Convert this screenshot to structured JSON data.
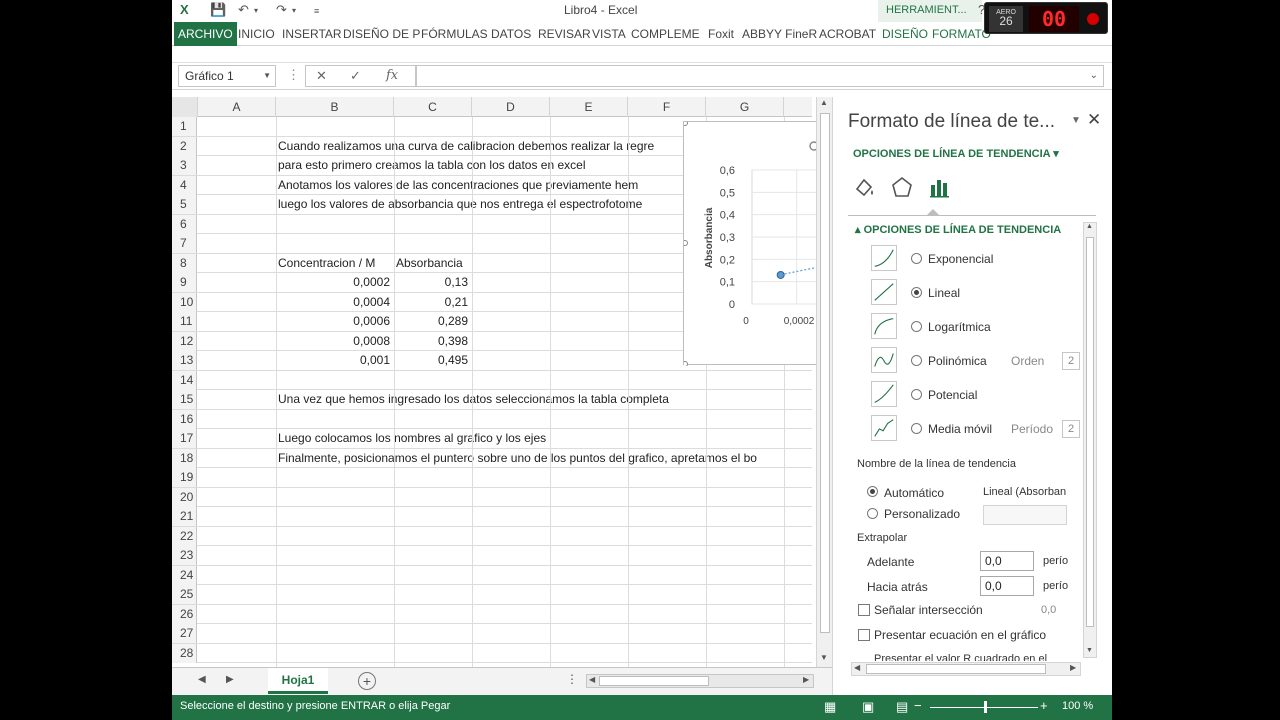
{
  "window": {
    "title": "Libro4 - Excel",
    "context_tab_group": "HERRAMIENT..."
  },
  "ribbon_tabs": [
    {
      "label": "ARCHIVO"
    },
    {
      "label": "INICIO"
    },
    {
      "label": "INSERTAR"
    },
    {
      "label": "DISEÑO DE P"
    },
    {
      "label": "FÓRMULAS"
    },
    {
      "label": "DATOS"
    },
    {
      "label": "REVISAR"
    },
    {
      "label": "VISTA"
    },
    {
      "label": "COMPLEME"
    },
    {
      "label": "Foxit"
    },
    {
      "label": "ABBYY FineR"
    },
    {
      "label": "ACROBAT"
    },
    {
      "label": "DISEÑO"
    },
    {
      "label": "FORMATO"
    }
  ],
  "formula_bar": {
    "name_box": "Gráfico 1",
    "fx_label": "fx",
    "value": ""
  },
  "columns": [
    "A",
    "B",
    "C",
    "D",
    "E",
    "F",
    "G"
  ],
  "rows": [
    {
      "n": "1"
    },
    {
      "n": "2",
      "b": "Cuando realizamos una curva de calibracion debemos realizar la regre"
    },
    {
      "n": "3",
      "b": "para esto primero creamos la tabla con los datos en excel"
    },
    {
      "n": "4",
      "b": "Anotamos los valores de las concentraciones que previamente hem"
    },
    {
      "n": "5",
      "b": "luego los valores de absorbancia que nos entrega el espectrofotome"
    },
    {
      "n": "6"
    },
    {
      "n": "7"
    },
    {
      "n": "8",
      "b": "Concentracion / M",
      "c": "Absorbancia"
    },
    {
      "n": "9",
      "b": "0,0002",
      "c": "0,13",
      "numeric": true
    },
    {
      "n": "10",
      "b": "0,0004",
      "c": "0,21",
      "numeric": true
    },
    {
      "n": "11",
      "b": "0,0006",
      "c": "0,289",
      "numeric": true
    },
    {
      "n": "12",
      "b": "0,0008",
      "c": "0,398",
      "numeric": true
    },
    {
      "n": "13",
      "b": "0,001",
      "c": "0,495",
      "numeric": true
    },
    {
      "n": "14"
    },
    {
      "n": "15",
      "b": "Una vez que hemos ingresado los datos seleccionamos la tabla completa"
    },
    {
      "n": "16"
    },
    {
      "n": "17",
      "b": "Luego colocamos los nombres al grafico y los ejes"
    },
    {
      "n": "18",
      "b": "Finalmente, posicionamos el puntero sobre uno de los puntos del grafico, apretamos el bo"
    },
    {
      "n": "19"
    },
    {
      "n": "20"
    },
    {
      "n": "21"
    },
    {
      "n": "22"
    },
    {
      "n": "23"
    },
    {
      "n": "24"
    },
    {
      "n": "25"
    },
    {
      "n": "26"
    },
    {
      "n": "27"
    },
    {
      "n": "28"
    }
  ],
  "chart_data": {
    "type": "scatter",
    "title": "",
    "ylabel": "Absorbancia",
    "xlabel": "",
    "y_ticks": [
      "0,6",
      "0,5",
      "0,4",
      "0,3",
      "0,2",
      "0,1",
      "0"
    ],
    "x_ticks": [
      "0",
      "0,0002"
    ],
    "ylim": [
      0,
      0.6
    ],
    "xlim": [
      0,
      0.0003
    ],
    "x": [
      0.0002
    ],
    "y": [
      0.13
    ],
    "trendline": true
  },
  "sheet": {
    "tab": "Hoja1"
  },
  "status": {
    "text": "Seleccione el destino y presione ENTRAR o elija Pegar",
    "zoom": "100 %"
  },
  "pane": {
    "title": "Formato de línea de te...",
    "subtitle": "OPCIONES DE LÍNEA DE TENDENCIA",
    "section": "OPCIONES DE LÍNEA DE TENDENCIA",
    "types": [
      {
        "label": "Exponencial",
        "selected": false
      },
      {
        "label": "Lineal",
        "selected": true
      },
      {
        "label": "Logarítmica",
        "selected": false
      },
      {
        "label": "Polinómica",
        "selected": false,
        "param_label": "Orden",
        "param_value": "2"
      },
      {
        "label": "Potencial",
        "selected": false
      },
      {
        "label": "Media móvil",
        "selected": false,
        "param_label": "Período",
        "param_value": "2"
      }
    ],
    "name_label": "Nombre de la línea de tendencia",
    "auto_label": "Automático",
    "auto_value": "Lineal (Absorban",
    "custom_label": "Personalizado",
    "extrapolate_label": "Extrapolar",
    "forward_label": "Adelante",
    "forward_value": "0,0",
    "forward_unit": "perío",
    "backward_label": "Hacia atrás",
    "backward_value": "0,0",
    "backward_unit": "perío",
    "intercept_label": "Señalar intersección",
    "intercept_value": "0,0",
    "equation_label": "Presentar ecuación en el gráfico",
    "r2_label": "Presentar el valor R cuadrado en el"
  },
  "overlay": {
    "aero_label": "AERO",
    "aero_num": "26",
    "counter": "00"
  },
  "colors": {
    "accent": "#217346"
  }
}
